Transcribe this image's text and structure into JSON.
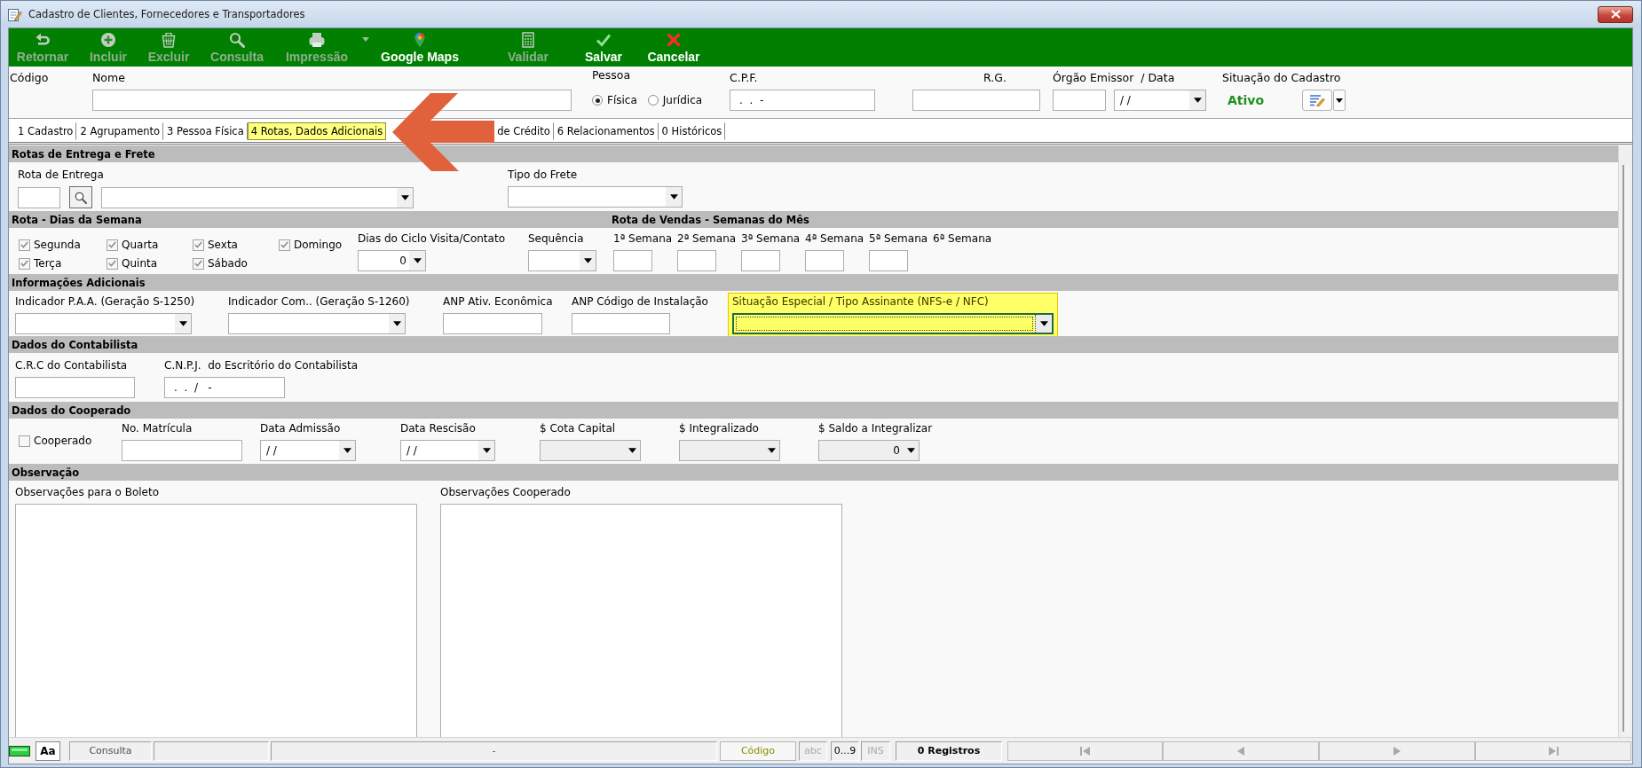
{
  "window": {
    "title": "Cadastro de Clientes, Fornecedores e Transportadores"
  },
  "toolbar": [
    {
      "kind": "return",
      "label": "Retornar",
      "disabled": true,
      "menu": false
    },
    {
      "kind": "add",
      "label": "Incluir",
      "disabled": true,
      "menu": false
    },
    {
      "kind": "delete",
      "label": "Excluir",
      "disabled": true,
      "menu": false
    },
    {
      "kind": "search",
      "label": "Consulta",
      "disabled": true,
      "menu": false
    },
    {
      "kind": "print",
      "label": "Impressão",
      "disabled": true,
      "menu": true
    },
    {
      "kind": "map",
      "label": "Google Maps",
      "disabled": false,
      "menu": false
    },
    {
      "kind": "validate",
      "label": "Validar",
      "disabled": true,
      "menu": false
    },
    {
      "kind": "save",
      "label": "Salvar",
      "disabled": false,
      "menu": false
    },
    {
      "kind": "cancel",
      "label": "Cancelar",
      "disabled": false,
      "menu": false
    }
  ],
  "header": {
    "codigo": {
      "label": "Código"
    },
    "nome": {
      "label": "Nome"
    },
    "pessoa": {
      "label": "Pessoa",
      "options": [
        {
          "label": "Física",
          "selected": true
        },
        {
          "label": "Jurídica",
          "selected": false
        }
      ]
    },
    "cpf": {
      "label": "C.P.F.",
      "value": ".  .  -"
    },
    "rg": {
      "label": "R.G."
    },
    "orgao": {
      "label": "Órgão Emissor  / Data",
      "date": "/ /"
    },
    "situacao": {
      "label": "Situação do Cadastro",
      "value": "Ativo"
    }
  },
  "tabs": [
    {
      "label": "1 Cadastro",
      "selected": false
    },
    {
      "label": "2 Agrupamento",
      "selected": false
    },
    {
      "label": "3 Pessoa Física",
      "selected": false
    },
    {
      "label": "4 Rotas, Dados Adicionais",
      "selected": true
    },
    {
      "label": "de Crédito",
      "selected": false
    },
    {
      "label": "6 Relacionamentos",
      "selected": false
    },
    {
      "label": "0 Históricos",
      "selected": false
    }
  ],
  "sections": [
    {
      "kind": "entrega",
      "title": "Rotas de Entrega e Frete",
      "fields": [
        {
          "kind": "route",
          "label": "Rota de Entrega"
        },
        {
          "kind": "combo",
          "label": "Tipo do Frete"
        }
      ]
    },
    {
      "kind": "dias",
      "title": "Rota - Dias da Semana",
      "title_2": "Rota de Vendas - Semanas do Mês",
      "days": [
        {
          "label": "Segunda",
          "checked": true
        },
        {
          "label": "Quarta",
          "checked": true
        },
        {
          "label": "Sexta",
          "checked": true
        },
        {
          "label": "Domingo",
          "checked": true
        },
        {
          "label": "Terça",
          "checked": true
        },
        {
          "label": "Quinta",
          "checked": true
        },
        {
          "label": "Sábado",
          "checked": true
        }
      ],
      "fields": [
        {
          "kind": "numeric",
          "label": "Dias do Ciclo Visita/Contato",
          "value": "0"
        },
        {
          "kind": "combo",
          "label": "Sequência"
        }
      ],
      "weeks": [
        {
          "label": "1ª Semana",
          "field": true
        },
        {
          "label": "2ª Semana",
          "field": true
        },
        {
          "label": "3ª Semana",
          "field": true
        },
        {
          "label": "4ª Semana",
          "field": true
        },
        {
          "label": "5ª Semana",
          "field": true
        },
        {
          "label": "6ª Semana",
          "field": false
        }
      ]
    },
    {
      "kind": "info",
      "title": "Informações Adicionais",
      "fields": [
        {
          "kind": "combo",
          "label": "Indicador P.A.A. (Geração S-1250)",
          "focused": false
        },
        {
          "kind": "combo",
          "label": "Indicador Com.. (Geração S-1260)",
          "focused": false
        },
        {
          "kind": "input",
          "label": "ANP Ativ. Econômica",
          "focused": false
        },
        {
          "kind": "input",
          "label": "ANP Código de Instalação",
          "focused": false
        },
        {
          "kind": "combo",
          "label": "Situação Especial / Tipo Assinante (NFS-e / NFC)",
          "focused": true
        }
      ]
    },
    {
      "kind": "contab",
      "title": "Dados do Contabilista",
      "fields": [
        {
          "kind": "input",
          "label": "C.R.C do Contabilista"
        },
        {
          "kind": "input",
          "label": "C.N.P.J.  do Escritório do Contabilista",
          "value": ".  .  /   -"
        }
      ]
    },
    {
      "kind": "coop",
      "title": "Dados do Cooperado",
      "fields": [
        {
          "kind": "checkbox",
          "label": "Cooperado",
          "checked": false,
          "disabled": false
        },
        {
          "kind": "input",
          "label": "No. Matrícula",
          "disabled": false
        },
        {
          "kind": "combo",
          "label": "Data Admissão",
          "value": "/ /",
          "disabled": false
        },
        {
          "kind": "combo",
          "label": "Data Rescisão",
          "value": "/ /",
          "disabled": false
        },
        {
          "kind": "combo",
          "label": "$ Cota Capital",
          "disabled": true
        },
        {
          "kind": "combo",
          "label": "$ Integralizado",
          "disabled": true
        },
        {
          "kind": "numeric",
          "label": "$ Saldo a Integralizar",
          "value": "0",
          "disabled": true
        }
      ]
    },
    {
      "kind": "obs",
      "title": "Observação",
      "fields": [
        {
          "kind": "textarea",
          "label": "Observações para o Boleto"
        },
        {
          "kind": "textarea",
          "label": "Observações Cooperado"
        }
      ]
    }
  ],
  "status_bar": {
    "font_button": "Aa",
    "mode": "Consulta",
    "message": "-",
    "key_button": "Código",
    "keys": [
      {
        "label": "abc",
        "on": false
      },
      {
        "label": "0...9",
        "on": true
      },
      {
        "label": "INS",
        "on": false
      }
    ],
    "count": "0 Registros",
    "nav": [
      {
        "kind": "first",
        "disabled": true
      },
      {
        "kind": "previous",
        "disabled": true
      },
      {
        "kind": "next",
        "disabled": true
      },
      {
        "kind": "last",
        "disabled": true
      }
    ]
  }
}
